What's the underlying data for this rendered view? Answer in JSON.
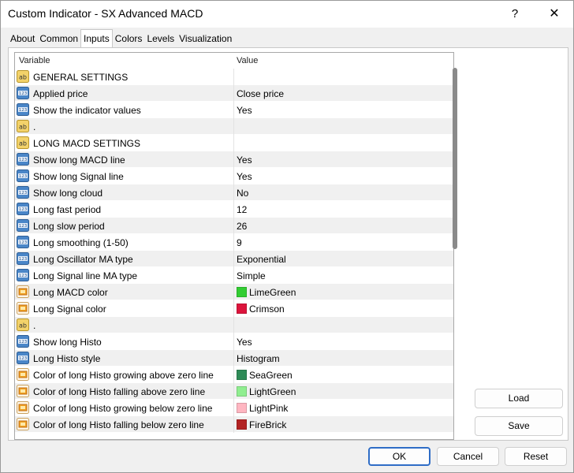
{
  "window": {
    "title": "Custom Indicator - SX Advanced MACD",
    "help_label": "?",
    "close_label": "✕"
  },
  "tabs": [
    {
      "label": "About"
    },
    {
      "label": "Common"
    },
    {
      "label": "Inputs"
    },
    {
      "label": "Colors"
    },
    {
      "label": "Levels"
    },
    {
      "label": "Visualization"
    }
  ],
  "active_tab": "Inputs",
  "grid": {
    "headers": {
      "variable": "Variable",
      "value": "Value"
    },
    "rows": [
      {
        "type": "ab",
        "variable": "GENERAL SETTINGS",
        "value": ""
      },
      {
        "type": "123",
        "variable": "Applied price",
        "value": "Close price"
      },
      {
        "type": "123",
        "variable": "Show the indicator values",
        "value": "Yes"
      },
      {
        "type": "ab",
        "variable": ".",
        "value": ""
      },
      {
        "type": "ab",
        "variable": "LONG MACD SETTINGS",
        "value": ""
      },
      {
        "type": "123",
        "variable": "Show long MACD line",
        "value": "Yes"
      },
      {
        "type": "123",
        "variable": "Show long Signal line",
        "value": "Yes"
      },
      {
        "type": "123",
        "variable": "Show long cloud",
        "value": "No"
      },
      {
        "type": "123",
        "variable": "Long fast period",
        "value": "12"
      },
      {
        "type": "123",
        "variable": "Long slow period",
        "value": "26"
      },
      {
        "type": "123",
        "variable": "Long smoothing (1-50)",
        "value": "9"
      },
      {
        "type": "123",
        "variable": "Long Oscillator MA type",
        "value": "Exponential"
      },
      {
        "type": "123",
        "variable": "Long Signal line MA type",
        "value": "Simple"
      },
      {
        "type": "color",
        "variable": "Long MACD color",
        "value": "LimeGreen",
        "color": "#32cd32"
      },
      {
        "type": "color",
        "variable": "Long Signal color",
        "value": "Crimson",
        "color": "#dc143c"
      },
      {
        "type": "ab",
        "variable": ".",
        "value": ""
      },
      {
        "type": "123",
        "variable": "Show long Histo",
        "value": "Yes"
      },
      {
        "type": "123",
        "variable": "Long Histo style",
        "value": "Histogram"
      },
      {
        "type": "color",
        "variable": "Color of long Histo growing above zero line",
        "value": "SeaGreen",
        "color": "#2e8b57"
      },
      {
        "type": "color",
        "variable": "Color of long Histo falling above zero line",
        "value": "LightGreen",
        "color": "#90ee90"
      },
      {
        "type": "color",
        "variable": "Color of long Histo growing below zero line",
        "value": "LightPink",
        "color": "#ffb6c1"
      },
      {
        "type": "color",
        "variable": "Color of long Histo falling below zero line",
        "value": "FireBrick",
        "color": "#b22222"
      }
    ]
  },
  "side_buttons": {
    "load": "Load",
    "save": "Save"
  },
  "footer_buttons": {
    "ok": "OK",
    "cancel": "Cancel",
    "reset": "Reset"
  }
}
